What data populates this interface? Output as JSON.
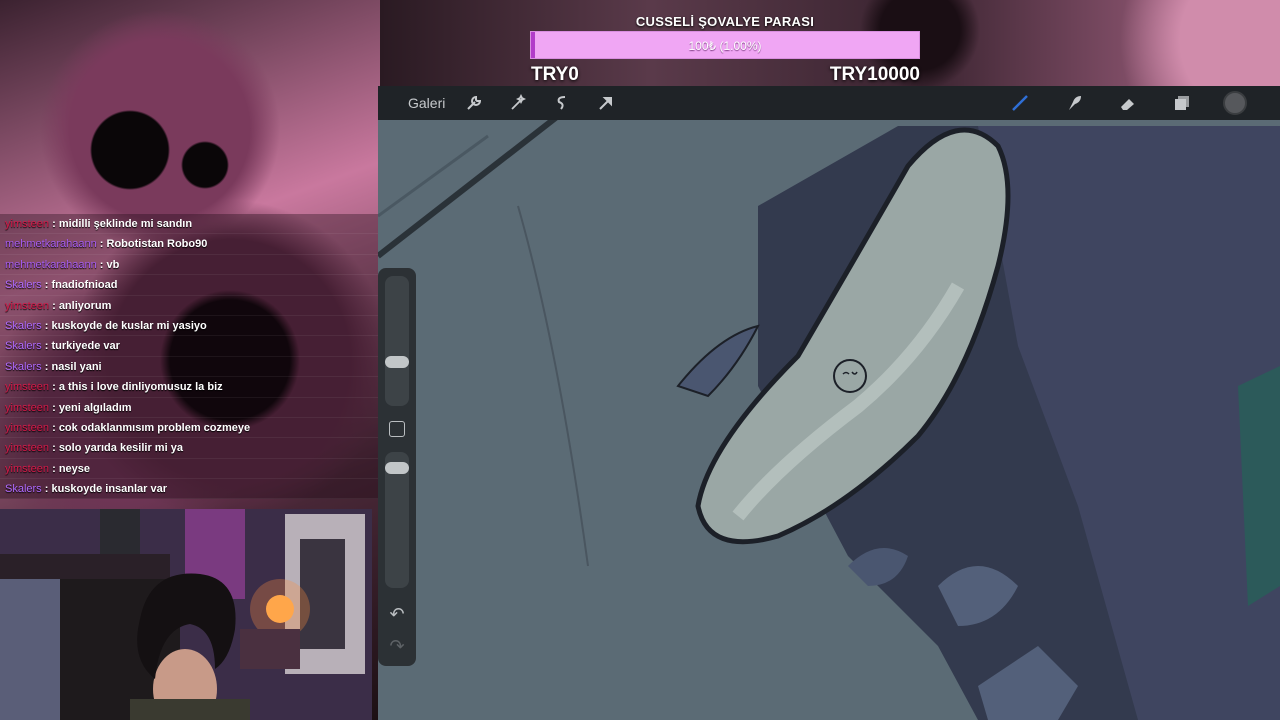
{
  "goal": {
    "title": "CUSSELİ ŞOVALYE PARASI",
    "progress_text": "100₺ (1.00%)",
    "progress_fraction": 0.01,
    "min_label": "TRY0",
    "max_label": "TRY10000",
    "bar_color": "#f0a6f4",
    "fill_color": "#b23cc9"
  },
  "toolbar": {
    "gallery_label": "Galeri",
    "left_icons": [
      "wrench-icon",
      "magic-wand-icon",
      "selection-icon",
      "transform-arrow-icon"
    ],
    "right_icons": [
      "brush-icon",
      "smudge-icon",
      "eraser-icon",
      "layers-icon"
    ],
    "brush_active_color": "#2f6fd6"
  },
  "chat": {
    "messages": [
      {
        "user": "yimsteen",
        "color": "#d61a4a",
        "text": "midilli şeklinde mi sandın"
      },
      {
        "user": "mehmetkarahaann",
        "color": "#a65cf0",
        "text": "Robotistan Robo90"
      },
      {
        "user": "mehmetkarahaann",
        "color": "#a65cf0",
        "text": "vb"
      },
      {
        "user": "Skalers",
        "color": "#b06aff",
        "text": "fnadiofnioad"
      },
      {
        "user": "yimsteen",
        "color": "#d61a4a",
        "text": "anliyorum"
      },
      {
        "user": "Skalers",
        "color": "#b06aff",
        "text": "kuskoyde de kuslar mi yasiyo"
      },
      {
        "user": "Skalers",
        "color": "#b06aff",
        "text": "turkiyede var"
      },
      {
        "user": "Skalers",
        "color": "#b06aff",
        "text": "nasil yani"
      },
      {
        "user": "yimsteen",
        "color": "#d61a4a",
        "text": "a this i love dinliyomusuz la biz"
      },
      {
        "user": "yimsteen",
        "color": "#d61a4a",
        "text": "yeni algıladım"
      },
      {
        "user": "yimsteen",
        "color": "#d61a4a",
        "text": "cok odaklanmısım problem cozmeye"
      },
      {
        "user": "yimsteen",
        "color": "#d61a4a",
        "text": "solo yarıda kesilir mi ya"
      },
      {
        "user": "yimsteen",
        "color": "#d61a4a",
        "text": "neyse"
      },
      {
        "user": "Skalers",
        "color": "#b06aff",
        "text": "kuskoyde insanlar var"
      }
    ]
  }
}
